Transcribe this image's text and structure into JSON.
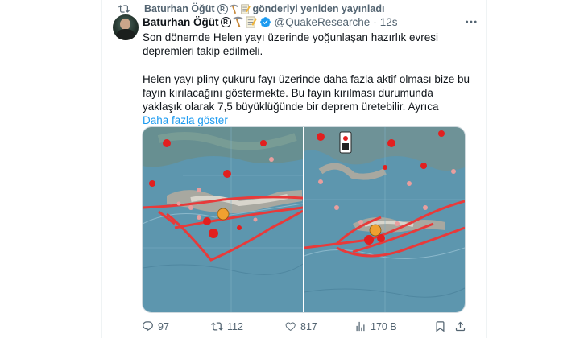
{
  "retweet": {
    "icon": "retweet-icon",
    "author": "Baturhan Öğüt",
    "suffix": "gönderiyi yeniden yayınladı"
  },
  "tweet": {
    "display_name": "Baturhan Öğüt",
    "badges": [
      "registered-icon",
      "pickaxe-emoji-icon",
      "memo-emoji-icon"
    ],
    "verified": true,
    "handle": "@QuakeResearche",
    "separator": "·",
    "time": "12s",
    "paragraph1": "Son dönemde Helen yayı üzerinde yoğunlaşan hazırlık evresi depremleri takip edilmeli.",
    "paragraph2": "Helen yayı pliny çukuru fayı üzerinde daha fazla aktif olması bize bu fayın kırılacağını göstermekte. Bu fayın kırılması durumunda yaklaşık olarak 7,5 büyüklüğünde bir deprem üretebilir. Ayrıca",
    "show_more": "Daha fazla göster"
  },
  "media": {
    "count": 2,
    "images": [
      "earthquake-map-left",
      "earthquake-map-right"
    ]
  },
  "actions": {
    "replies": "97",
    "reposts": "112",
    "likes": "817",
    "views": "170 B"
  },
  "colors": {
    "accent": "#1d9bf0",
    "text": "#0f1419",
    "muted": "#536471",
    "retweet_green": "#00ba7c",
    "sea": "#5c95ad",
    "fault_line": "#e83a3a",
    "quake_marker": "#e21f1f",
    "quake_highlight": "#f0a030"
  }
}
